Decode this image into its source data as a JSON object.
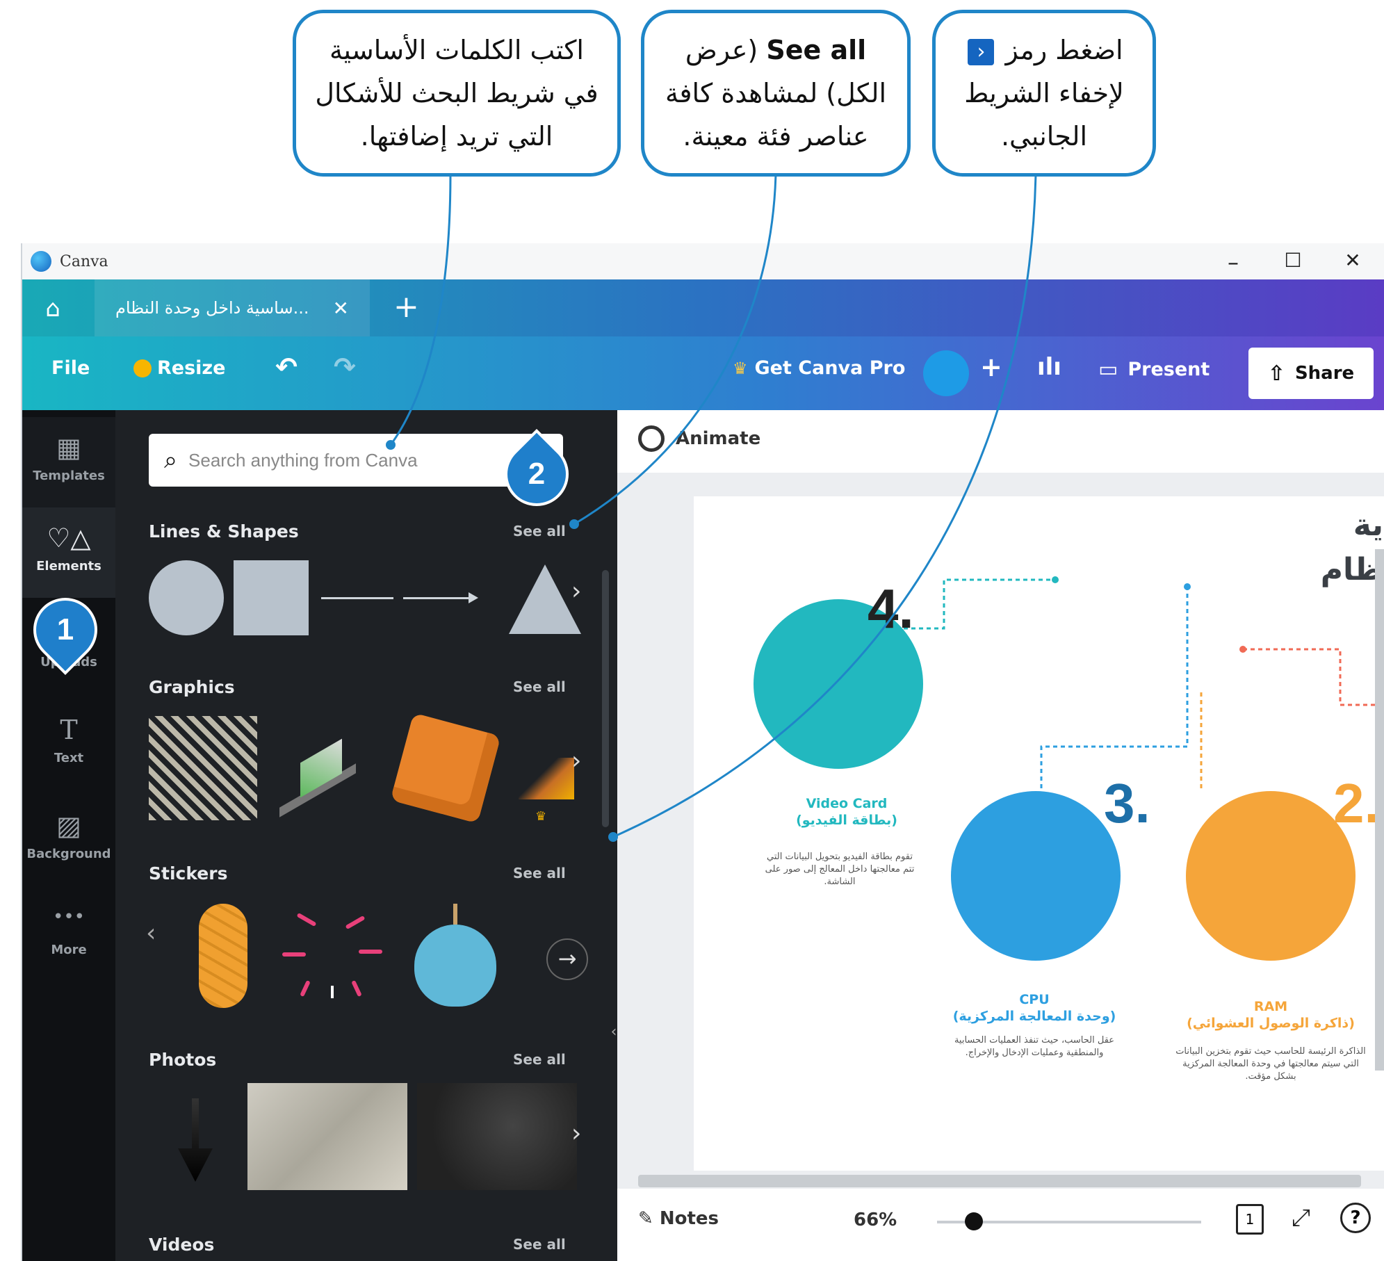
{
  "callouts": {
    "search_tip": {
      "line1": "اكتب الكلمات الأساسية",
      "line2": "في شريط البحث للأشكال",
      "line3": "التي تريد إضافتها."
    },
    "see_all_tip": {
      "line1_bold": "See all",
      "line1_rest": "(عرض",
      "line2": "الكل) لمشاهدة كافة",
      "line3": "عناصر فئة معينة."
    },
    "hide_tip": {
      "line1_pre": "اضغط رمز",
      "line1_icon": "‹",
      "line2": "لإخفاء الشريط",
      "line3": "الجانبي."
    }
  },
  "window": {
    "app_title": "Canva",
    "minimize": "–",
    "maximize": "☐",
    "close": "✕"
  },
  "tabs": {
    "home_icon": "⌂",
    "active_tab_title": "...ساسية داخل وحدة النظام",
    "close_tab": "✕",
    "new_tab": "+"
  },
  "menubar": {
    "file": "File",
    "resize": "Resize",
    "undo": "↶",
    "redo": "↷",
    "get_pro": "Get Canva Pro",
    "crown": "♛",
    "add": "+",
    "stats": "ılı",
    "present": "Present",
    "present_icon": "▭",
    "share": "Share",
    "share_icon": "⇧",
    "accent_color": "#1e9be6"
  },
  "rail": {
    "items": [
      {
        "label": "Templates",
        "icon": "▦"
      },
      {
        "label": "Elements",
        "icon": "♡△"
      },
      {
        "label": "Uploads",
        "icon": "☁"
      },
      {
        "label": "Text",
        "icon": "T"
      },
      {
        "label": "Background",
        "icon": "▨"
      },
      {
        "label": "More",
        "icon": "•••"
      }
    ]
  },
  "panel": {
    "search_icon": "⌕",
    "search_placeholder": "Search anything from Canva",
    "see_all": "See all",
    "next": "›",
    "prev": "‹",
    "sections": {
      "lines_shapes": "Lines & Shapes",
      "graphics": "Graphics",
      "stickers": "Stickers",
      "photos": "Photos",
      "videos": "Videos"
    }
  },
  "canvas": {
    "animate": "Animate",
    "title_line1": "ية",
    "title_line2": "ظام",
    "collapse_icon": "‹",
    "items": [
      {
        "num": "4.",
        "en": "Video Card",
        "ar": "(بطاقة الفيديو)",
        "desc": "تقوم بطاقة الفيديو بتحويل البيانات التي تتم معالجتها داخل المعالج إلى صور على الشاشة.",
        "color": "#22b8bf"
      },
      {
        "num": "3.",
        "en": "CPU",
        "ar": "(وحدة المعالجة المركزية)",
        "desc": "عقل الحاسب، حيث تنفذ العمليات الحسابية والمنطقية وعمليات الإدخال والإخراج.",
        "color": "#2d9fe0"
      },
      {
        "num": "2.",
        "en": "RAM",
        "ar": "(ذاكرة الوصول العشوائي)",
        "desc": "الذاكرة الرئيسة للحاسب حيث تقوم بتخزين البيانات التي سيتم معالجتها في وحدة المعالجة المركزية بشكل مؤقت.",
        "color": "#f5a53a"
      }
    ]
  },
  "bottombar": {
    "notes": "Notes",
    "notes_icon": "✎",
    "zoom": "66%",
    "page_num": "1",
    "fullscreen": "⤢",
    "help": "?"
  },
  "markers": {
    "step1": "1",
    "step2": "2"
  }
}
